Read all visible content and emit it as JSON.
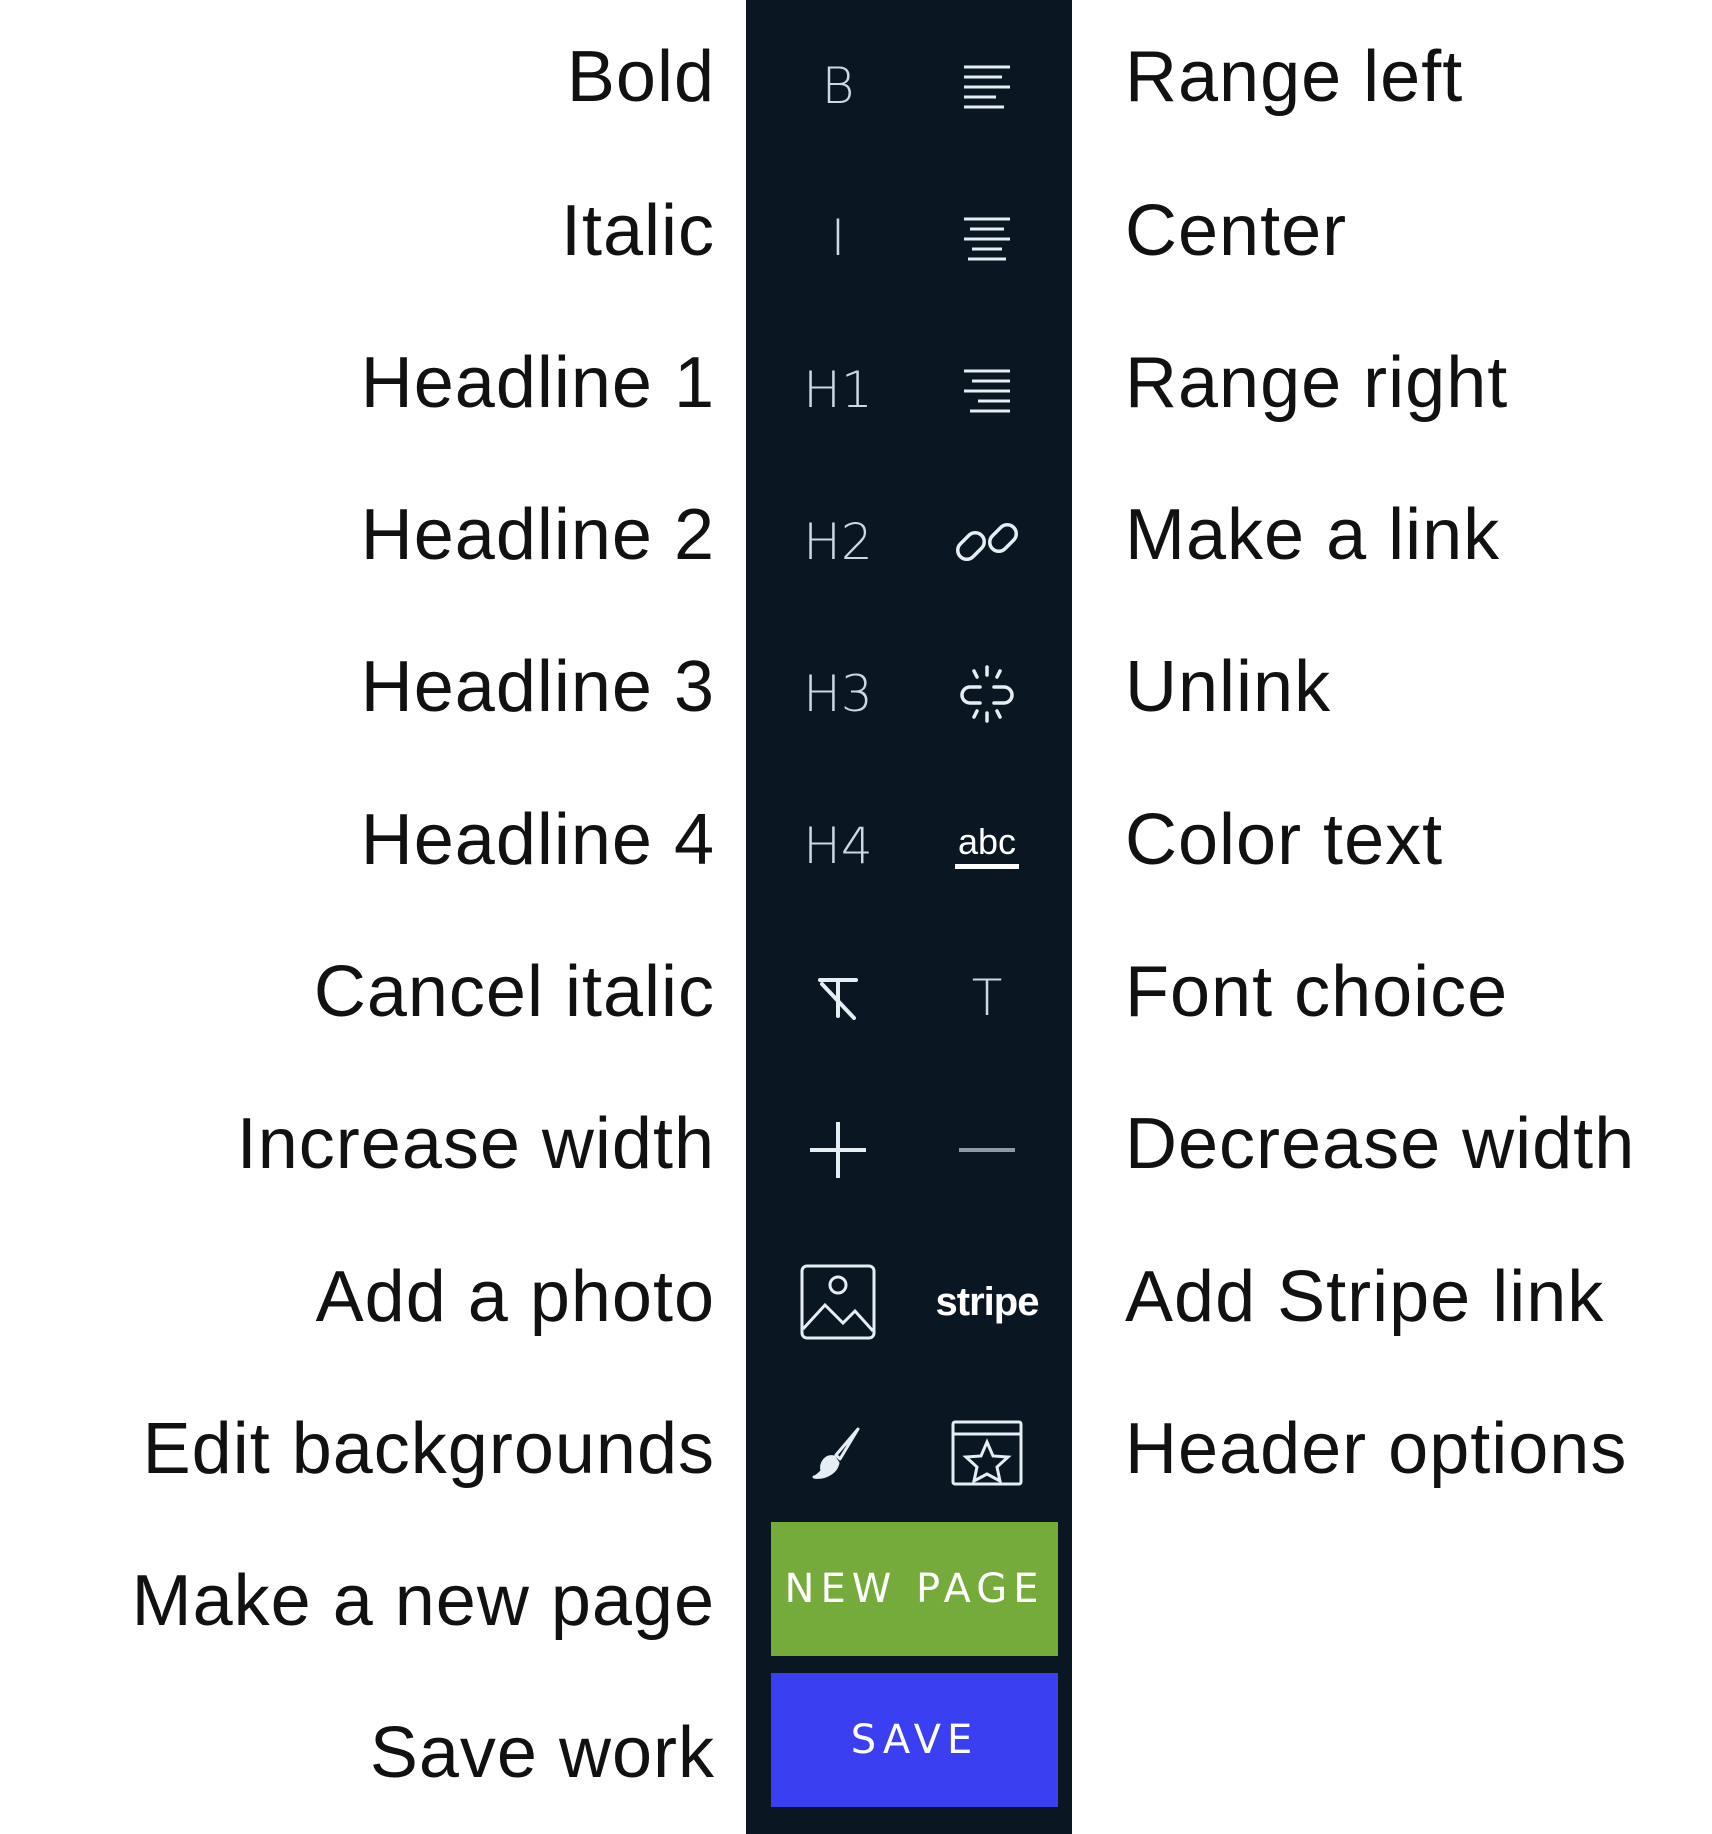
{
  "left_labels": [
    "Bold",
    "Italic",
    "Headline 1",
    "Headline 2",
    "Headline 3",
    "Headline 4",
    "Cancel italic",
    "Increase width",
    "Add a photo",
    "Edit backgrounds",
    "Make a new page",
    "Save work"
  ],
  "right_labels": [
    "Range left",
    "Center",
    "Range right",
    "Make a link",
    "Unlink",
    "Color text",
    "Font choice",
    "Decrease width",
    "Add Stripe link",
    "Header options"
  ],
  "toolbar": {
    "left_icons": [
      "bold-icon",
      "italic-icon",
      "h1-icon",
      "h2-icon",
      "h3-icon",
      "h4-icon",
      "clear-italic-icon",
      "plus-icon",
      "photo-icon",
      "brush-icon"
    ],
    "right_icons": [
      "align-left-icon",
      "align-center-icon",
      "align-right-icon",
      "link-icon",
      "unlink-icon",
      "color-text-icon",
      "font-choice-icon",
      "minus-icon",
      "stripe-icon",
      "header-options-icon"
    ],
    "glyphs": {
      "bold": "B",
      "italic": "I",
      "h1": "H1",
      "h2": "H2",
      "h3": "H3",
      "h4": "H4",
      "font": "T",
      "abc": "abc",
      "stripe": "stripe"
    },
    "new_page_button": "NEW PAGE",
    "save_button": "SAVE"
  },
  "colors": {
    "toolbar_bg": "#0a1622",
    "new_page_bg": "#74ab3a",
    "save_bg": "#3a3ff2",
    "icon": "#e6edf3"
  }
}
